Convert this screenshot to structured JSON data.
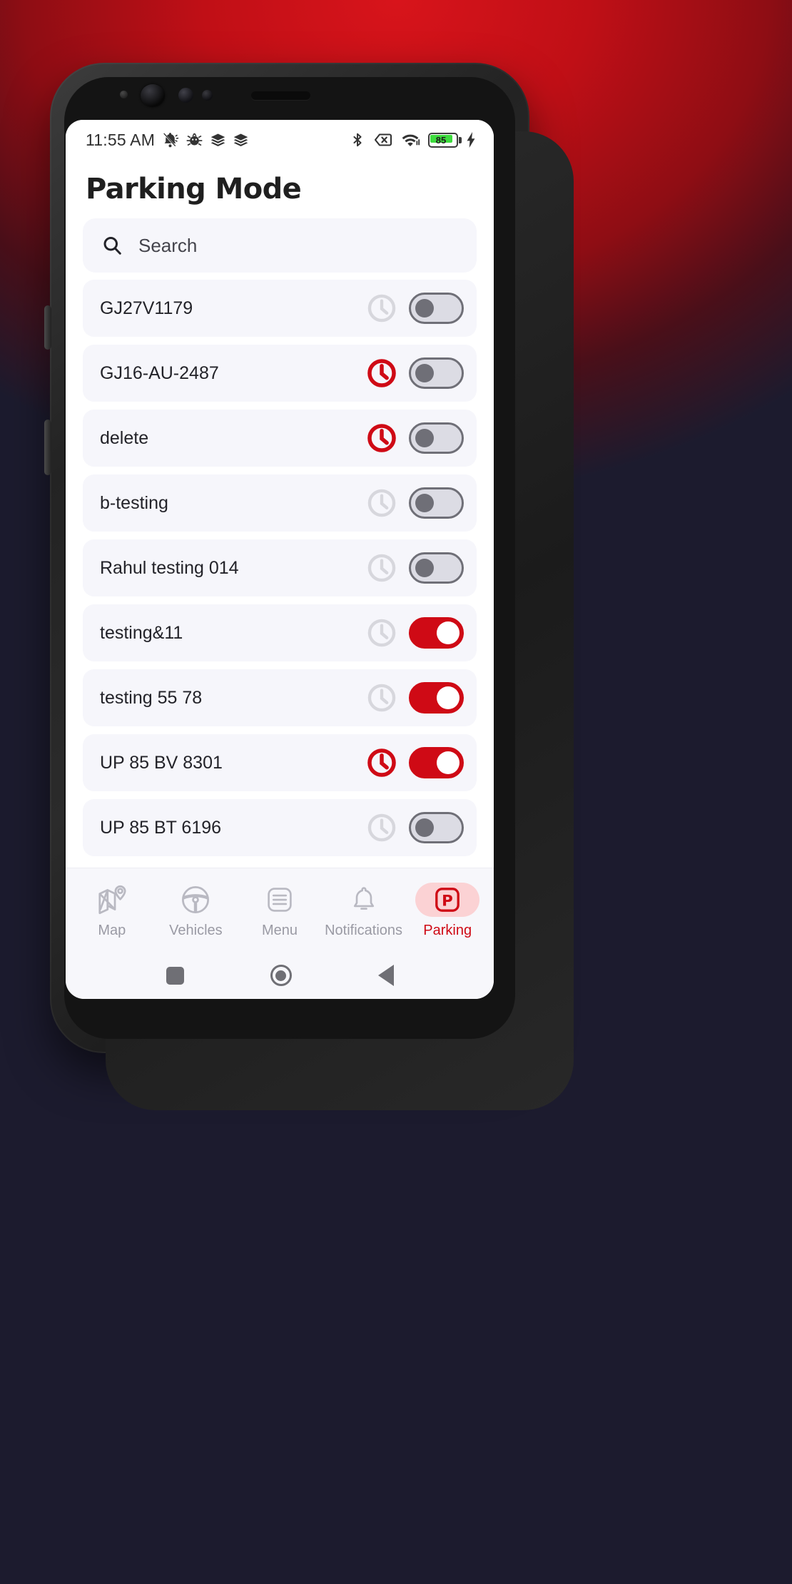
{
  "status_bar": {
    "time": "11:55 AM",
    "left_icons": [
      "bell-slash-icon",
      "bug-icon",
      "layers-icon",
      "layers-icon"
    ],
    "right_icons": [
      "bluetooth-icon",
      "sim-card-off-icon",
      "wifi-icon",
      "battery-icon",
      "charging-bolt-icon"
    ],
    "battery_percent": "85",
    "battery_color": "#3ddb3d"
  },
  "header": {
    "title": "Parking Mode"
  },
  "search": {
    "placeholder": "Search",
    "value": "",
    "icon": "search-icon"
  },
  "theme": {
    "accent": "#cf0a15",
    "accent_soft": "#fbd2d4",
    "row_bg": "#f6f6fb",
    "toggle_off_track": "#dcdce4",
    "toggle_off_thumb": "#6f6f77",
    "clock_inactive": "#d7d7dd",
    "clock_active": "#cf0a15"
  },
  "list": {
    "items": [
      {
        "label": "GJ27V1179",
        "clock_active": false,
        "toggle_on": false
      },
      {
        "label": "GJ16-AU-2487",
        "clock_active": true,
        "toggle_on": false
      },
      {
        "label": "delete",
        "clock_active": true,
        "toggle_on": false
      },
      {
        "label": "b-testing",
        "clock_active": false,
        "toggle_on": false
      },
      {
        "label": "Rahul testing 014",
        "clock_active": false,
        "toggle_on": false
      },
      {
        "label": "testing&11",
        "clock_active": false,
        "toggle_on": true
      },
      {
        "label": "testing 55 78",
        "clock_active": false,
        "toggle_on": true
      },
      {
        "label": "UP 85 BV 8301",
        "clock_active": true,
        "toggle_on": true
      },
      {
        "label": "UP 85 BT 6196",
        "clock_active": false,
        "toggle_on": false
      }
    ]
  },
  "bottom_nav": {
    "items": [
      {
        "label": "Map",
        "icon": "map-pin-icon",
        "active": false
      },
      {
        "label": "Vehicles",
        "icon": "steering-wheel-icon",
        "active": false
      },
      {
        "label": "Menu",
        "icon": "list-menu-icon",
        "active": false
      },
      {
        "label": "Notifications",
        "icon": "bell-icon",
        "active": false
      },
      {
        "label": "Parking",
        "icon": "parking-p-icon",
        "active": true
      }
    ]
  },
  "system_nav": {
    "recents": "square-recents-icon",
    "home": "circle-home-icon",
    "back": "triangle-back-icon"
  }
}
